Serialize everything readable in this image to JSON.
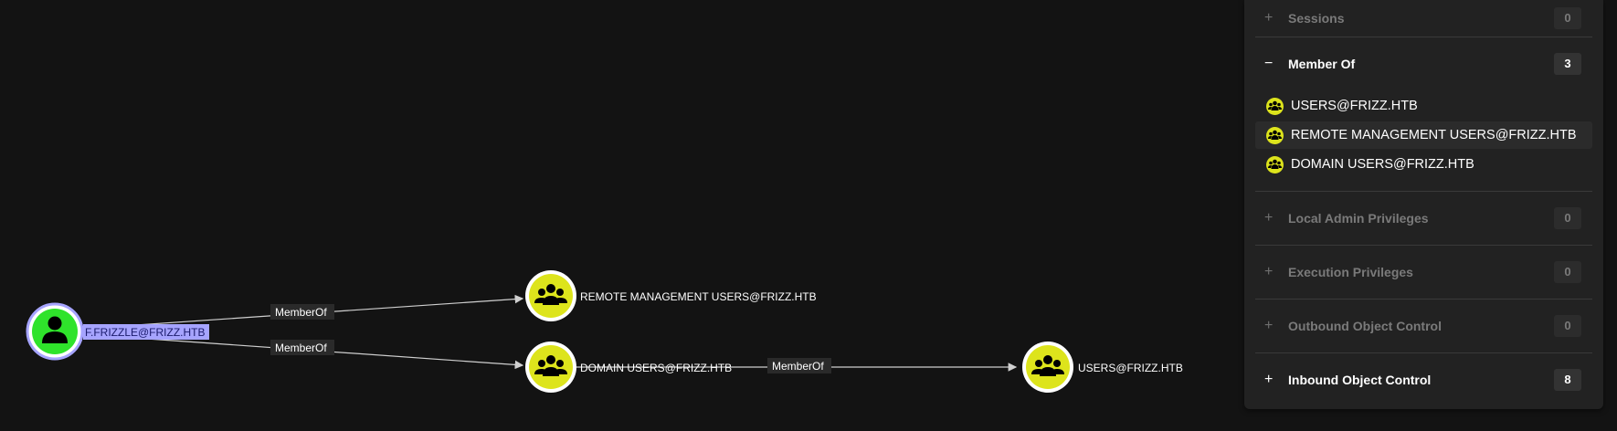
{
  "graph": {
    "nodes": [
      {
        "id": "user",
        "label": "F.FRIZZLE@FRIZZ.HTB",
        "type": "user",
        "color": "#2fe32b",
        "ring": "#a6a4ff"
      },
      {
        "id": "rmu",
        "label": "REMOTE MANAGEMENT USERS@FRIZZ.HTB",
        "type": "group",
        "color": "#dde41c"
      },
      {
        "id": "du",
        "label": "DOMAIN USERS@FRIZZ.HTB",
        "type": "group",
        "color": "#dde41c"
      },
      {
        "id": "users",
        "label": "USERS@FRIZZ.HTB",
        "type": "group",
        "color": "#dde41c"
      }
    ],
    "edges": [
      {
        "from": "user",
        "to": "rmu",
        "label": "MemberOf"
      },
      {
        "from": "user",
        "to": "du",
        "label": "MemberOf"
      },
      {
        "from": "du",
        "to": "users",
        "label": "MemberOf"
      }
    ]
  },
  "panel": {
    "sections": [
      {
        "title": "Sessions",
        "count": "0",
        "toggle": "+",
        "active": false
      },
      {
        "title": "Member Of",
        "count": "3",
        "toggle": "−",
        "active": true,
        "items": [
          "USERS@FRIZZ.HTB",
          "REMOTE MANAGEMENT USERS@FRIZZ.HTB",
          "DOMAIN USERS@FRIZZ.HTB"
        ]
      },
      {
        "title": "Local Admin Privileges",
        "count": "0",
        "toggle": "+",
        "active": false
      },
      {
        "title": "Execution Privileges",
        "count": "0",
        "toggle": "+",
        "active": false
      },
      {
        "title": "Outbound Object Control",
        "count": "0",
        "toggle": "+",
        "active": false
      },
      {
        "title": "Inbound Object Control",
        "count": "8",
        "toggle": "+",
        "active": true
      }
    ]
  },
  "icons": {
    "user_node": "person-icon",
    "group_node": "group-icon"
  }
}
